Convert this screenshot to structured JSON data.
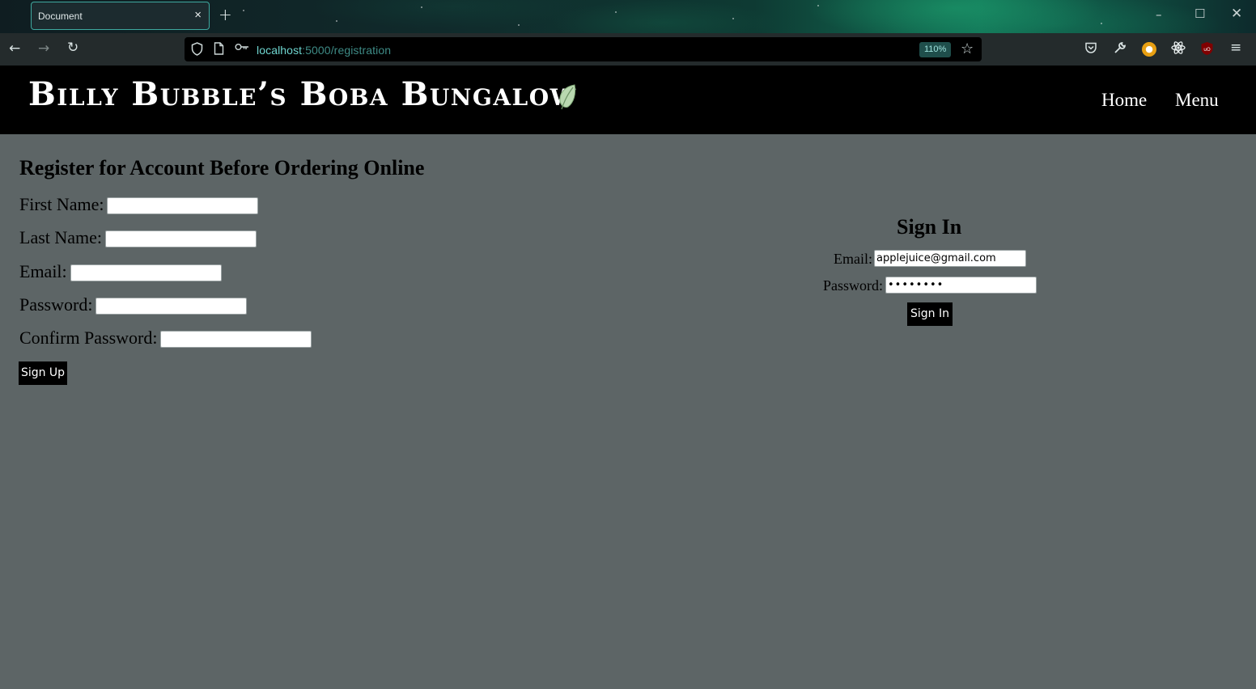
{
  "browser": {
    "tab_title": "Document",
    "tab_close": "×",
    "new_tab": "+",
    "url_host": "localhost",
    "url_path": ":5000/registration",
    "zoom": "110%",
    "icons": [
      "back-icon",
      "forward-icon",
      "reload-icon",
      "shield-icon",
      "page-icon",
      "key-icon",
      "star-icon",
      "pocket-icon",
      "wrench-icon",
      "extension-icon",
      "react-icon",
      "ublock-icon",
      "hamburger-menu-icon"
    ]
  },
  "site": {
    "brand": "Billy Bubble’s Boba Bungalow",
    "nav": {
      "home": "Home",
      "menu": "Menu"
    }
  },
  "register": {
    "title": "Register for Account Before Ordering Online",
    "first_name_label": "First Name:",
    "last_name_label": "Last Name:",
    "email_label": "Email:",
    "password_label": "Password:",
    "confirm_password_label": "Confirm Password:",
    "submit_label": "Sign Up"
  },
  "signin": {
    "title": "Sign In",
    "email_label": "Email:",
    "email_value": "applejuice@gmail.com",
    "password_label": "Password:",
    "password_value": "••••••••",
    "submit_label": "Sign In"
  },
  "colors": {
    "page_background": "#5d6566",
    "header_background": "#000000",
    "button_background": "#000000",
    "url_accent": "#6fd6d0"
  }
}
